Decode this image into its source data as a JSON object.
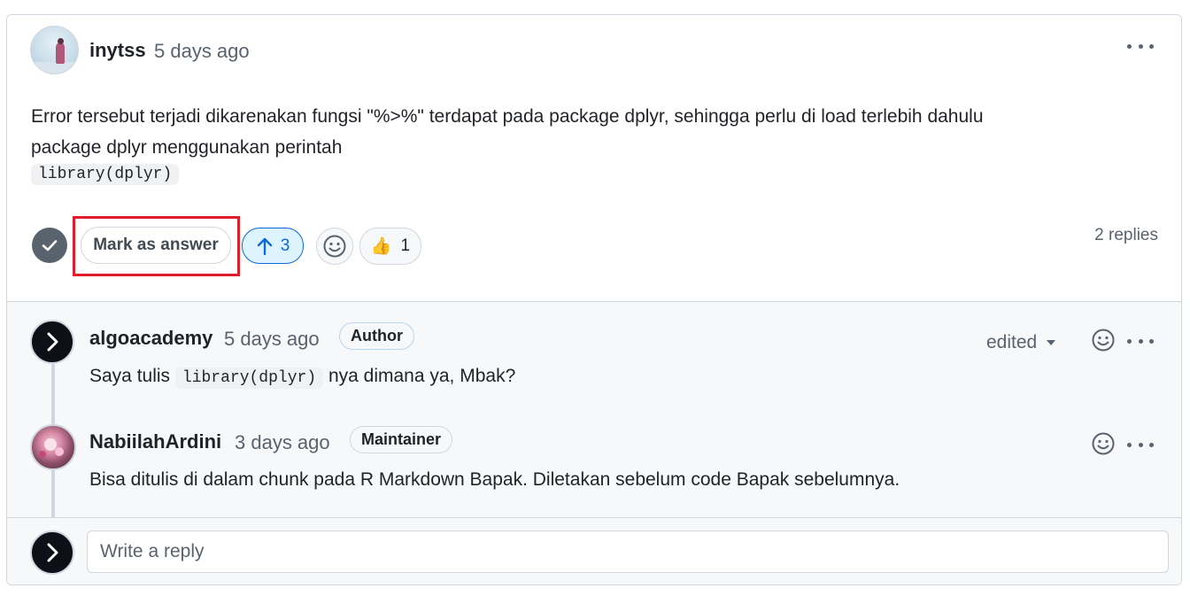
{
  "post": {
    "author": "inytss",
    "time": "5 days ago",
    "body_line1": "Error tersebut terjadi dikarenakan fungsi \"%>%\" terdapat pada package dplyr, sehingga perlu di load terlebih dahulu",
    "body_line2": "package dplyr menggunakan perintah",
    "code": "library(dplyr)",
    "mark_answer_label": "Mark as answer",
    "upvote_count": "3",
    "thumbs_emoji": "👍",
    "thumbs_count": "1",
    "replies_label": "2 replies"
  },
  "replies": [
    {
      "author": "algoacademy",
      "time": "5 days ago",
      "badge": "Author",
      "text_before": "Saya tulis",
      "code": "library(dplyr)",
      "text_after": "nya dimana ya, Mbak?",
      "edited_label": "edited"
    },
    {
      "author": "NabiilahArdini",
      "time": "3 days ago",
      "badge": "Maintainer",
      "text": "Bisa ditulis di dalam chunk pada R Markdown Bapak. Diletakan sebelum code Bapak sebelumnya."
    }
  ],
  "reply_box": {
    "placeholder": "Write a reply"
  },
  "colors": {
    "accent_blue": "#0969da",
    "highlight_red": "#e11d2b"
  },
  "icons": [
    "kebab-icon",
    "check-icon",
    "arrow-up-icon",
    "smiley-icon",
    "thumbs-up-icon",
    "chevron-down-icon",
    "chevron-right-icon"
  ]
}
